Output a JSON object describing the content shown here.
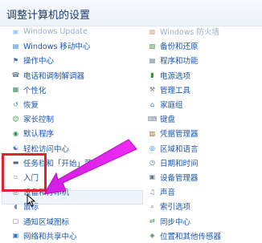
{
  "window": {
    "title": "调整计算机的设置"
  },
  "left_items": [
    {
      "label": "Windows Update",
      "icon": "windows-update-icon",
      "color": "#2a7de1",
      "glyph": "▣"
    },
    {
      "label": "Windows 移动中心",
      "icon": "mobility-center-icon",
      "color": "#3a78c8",
      "glyph": "▤"
    },
    {
      "label": "操作中心",
      "icon": "action-center-flag-icon",
      "color": "#2e6fd0",
      "glyph": "⚑"
    },
    {
      "label": "电话和调制解调器",
      "icon": "phone-modem-icon",
      "color": "#6b7c93",
      "glyph": "☎"
    },
    {
      "label": "个性化",
      "icon": "personalization-icon",
      "color": "#3d8f5a",
      "glyph": "▦"
    },
    {
      "label": "恢复",
      "icon": "recovery-icon",
      "color": "#2f7fd8",
      "glyph": "↺"
    },
    {
      "label": "家长控制",
      "icon": "parental-controls-icon",
      "color": "#3b8a3b",
      "glyph": "☺"
    },
    {
      "label": "默认程序",
      "icon": "default-programs-icon",
      "color": "#2c8d3c",
      "glyph": "◉"
    },
    {
      "label": "轻松访问中心",
      "icon": "ease-of-access-icon",
      "color": "#2a6ed1",
      "glyph": "☯"
    },
    {
      "label": "任务栏和「开始」菜单",
      "icon": "taskbar-start-menu-icon",
      "color": "#555f6e",
      "glyph": "▬"
    },
    {
      "label": "入门",
      "icon": "getting-started-icon",
      "color": "#8a9aae",
      "glyph": "▫"
    },
    {
      "label": "设备和打印机",
      "icon": "devices-printers-icon",
      "color": "#5a6577",
      "glyph": "⎙"
    },
    {
      "label": "鼠标",
      "icon": "mouse-icon",
      "color": "#7a8594",
      "glyph": "◖"
    },
    {
      "label": "通知区域图标",
      "icon": "notification-area-icon",
      "color": "#6a7686",
      "glyph": "▢"
    },
    {
      "label": "网络和共享中心",
      "icon": "network-sharing-icon",
      "color": "#3470c9",
      "glyph": "▣"
    }
  ],
  "right_items": [
    {
      "label": "Windows 防火墙",
      "icon": "firewall-icon",
      "color": "#b24a2a",
      "glyph": "▩"
    },
    {
      "label": "备份和还原",
      "icon": "backup-restore-icon",
      "color": "#3f8a3f",
      "glyph": "▧"
    },
    {
      "label": "程序和功能",
      "icon": "programs-features-icon",
      "color": "#5a6b80",
      "glyph": "▤"
    },
    {
      "label": "电源选项",
      "icon": "power-options-icon",
      "color": "#3f8a3f",
      "glyph": "▮"
    },
    {
      "label": "管理工具",
      "icon": "admin-tools-icon",
      "color": "#6a7686",
      "glyph": "⚒"
    },
    {
      "label": "家庭组",
      "icon": "homegroup-icon",
      "color": "#2e76c9",
      "glyph": "⌂"
    },
    {
      "label": "键盘",
      "icon": "keyboard-icon",
      "color": "#7a8594",
      "glyph": "⌨"
    },
    {
      "label": "凭据管理器",
      "icon": "credential-manager-icon",
      "color": "#8a6a2a",
      "glyph": "▥"
    },
    {
      "label": "区域和语言",
      "icon": "region-language-icon",
      "color": "#2e76c9",
      "glyph": "◎"
    },
    {
      "label": "日期和时间",
      "icon": "date-time-icon",
      "color": "#4a70b0",
      "glyph": "◷"
    },
    {
      "label": "设备管理器",
      "icon": "device-manager-icon",
      "color": "#6a7686",
      "glyph": "▣"
    },
    {
      "label": "声音",
      "icon": "sound-icon",
      "color": "#7a8594",
      "glyph": "♫"
    },
    {
      "label": "索引选项",
      "icon": "indexing-options-icon",
      "color": "#6a7686",
      "glyph": "⌕"
    },
    {
      "label": "同步中心",
      "icon": "sync-center-icon",
      "color": "#3f9a3f",
      "glyph": "⇄"
    },
    {
      "label": "位置和其他传感器",
      "icon": "location-sensors-icon",
      "color": "#3f8a5a",
      "glyph": "◈"
    }
  ]
}
